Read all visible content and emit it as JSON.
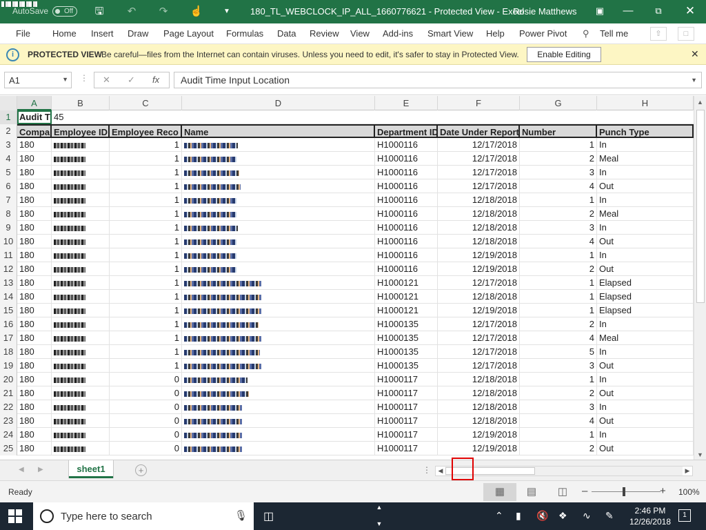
{
  "titlebar": {
    "autosave_label": "AutoSave",
    "autosave_state": "Off",
    "doc_title": "180_TL_WEBCLOCK_IP_ALL_1660776621 - Protected View - Excel",
    "user_name": "Rosie Matthews"
  },
  "menu": {
    "items": [
      "File",
      "Home",
      "Insert",
      "Draw",
      "Page Layout",
      "Formulas",
      "Data",
      "Review",
      "View",
      "Add-ins",
      "Smart View",
      "Help",
      "Power Pivot"
    ],
    "tell_me": "Tell me"
  },
  "protected_view": {
    "title": "PROTECTED VIEW",
    "message": "Be careful—files from the Internet can contain viruses. Unless you need to edit, it's safer to stay in Protected View.",
    "enable_button": "Enable Editing"
  },
  "formula_bar": {
    "name_box": "A1",
    "fx_label": "fx",
    "content": "Audit Time Input Location"
  },
  "columns": [
    "A",
    "B",
    "C",
    "D",
    "E",
    "F",
    "G",
    "H"
  ],
  "row1": {
    "a": "Audit T",
    "b": "45"
  },
  "header_row": [
    "Compa",
    "Employee ID",
    "Employee Reco",
    "Name",
    "Department ID",
    "Date Under Report",
    "Number",
    "Punch Type"
  ],
  "rows": [
    {
      "n": "3",
      "a": "180",
      "c": "1",
      "e": "H1000116",
      "f": "12/17/2018",
      "g": "1",
      "h": "In"
    },
    {
      "n": "4",
      "a": "180",
      "c": "1",
      "e": "H1000116",
      "f": "12/17/2018",
      "g": "2",
      "h": "Meal"
    },
    {
      "n": "5",
      "a": "180",
      "c": "1",
      "e": "H1000116",
      "f": "12/17/2018",
      "g": "3",
      "h": "In"
    },
    {
      "n": "6",
      "a": "180",
      "c": "1",
      "e": "H1000116",
      "f": "12/17/2018",
      "g": "4",
      "h": "Out"
    },
    {
      "n": "7",
      "a": "180",
      "c": "1",
      "e": "H1000116",
      "f": "12/18/2018",
      "g": "1",
      "h": "In"
    },
    {
      "n": "8",
      "a": "180",
      "c": "1",
      "e": "H1000116",
      "f": "12/18/2018",
      "g": "2",
      "h": "Meal"
    },
    {
      "n": "9",
      "a": "180",
      "c": "1",
      "e": "H1000116",
      "f": "12/18/2018",
      "g": "3",
      "h": "In"
    },
    {
      "n": "10",
      "a": "180",
      "c": "1",
      "e": "H1000116",
      "f": "12/18/2018",
      "g": "4",
      "h": "Out"
    },
    {
      "n": "11",
      "a": "180",
      "c": "1",
      "e": "H1000116",
      "f": "12/19/2018",
      "g": "1",
      "h": "In"
    },
    {
      "n": "12",
      "a": "180",
      "c": "1",
      "e": "H1000116",
      "f": "12/19/2018",
      "g": "2",
      "h": "Out"
    },
    {
      "n": "13",
      "a": "180",
      "c": "1",
      "e": "H1000121",
      "f": "12/17/2018",
      "g": "1",
      "h": "Elapsed"
    },
    {
      "n": "14",
      "a": "180",
      "c": "1",
      "e": "H1000121",
      "f": "12/18/2018",
      "g": "1",
      "h": "Elapsed"
    },
    {
      "n": "15",
      "a": "180",
      "c": "1",
      "e": "H1000121",
      "f": "12/19/2018",
      "g": "1",
      "h": "Elapsed"
    },
    {
      "n": "16",
      "a": "180",
      "c": "1",
      "e": "H1000135",
      "f": "12/17/2018",
      "g": "2",
      "h": "In"
    },
    {
      "n": "17",
      "a": "180",
      "c": "1",
      "e": "H1000135",
      "f": "12/17/2018",
      "g": "4",
      "h": "Meal"
    },
    {
      "n": "18",
      "a": "180",
      "c": "1",
      "e": "H1000135",
      "f": "12/17/2018",
      "g": "5",
      "h": "In"
    },
    {
      "n": "19",
      "a": "180",
      "c": "1",
      "e": "H1000135",
      "f": "12/17/2018",
      "g": "3",
      "h": "Out"
    },
    {
      "n": "20",
      "a": "180",
      "c": "0",
      "e": "H1000117",
      "f": "12/18/2018",
      "g": "1",
      "h": "In"
    },
    {
      "n": "21",
      "a": "180",
      "c": "0",
      "e": "H1000117",
      "f": "12/18/2018",
      "g": "2",
      "h": "Out"
    },
    {
      "n": "22",
      "a": "180",
      "c": "0",
      "e": "H1000117",
      "f": "12/18/2018",
      "g": "3",
      "h": "In"
    },
    {
      "n": "23",
      "a": "180",
      "c": "0",
      "e": "H1000117",
      "f": "12/18/2018",
      "g": "4",
      "h": "Out"
    },
    {
      "n": "24",
      "a": "180",
      "c": "0",
      "e": "H1000117",
      "f": "12/19/2018",
      "g": "1",
      "h": "In"
    },
    {
      "n": "25",
      "a": "180",
      "c": "0",
      "e": "H1000117",
      "f": "12/19/2018",
      "g": "2",
      "h": "Out"
    }
  ],
  "row_labels": {
    "r1": "1",
    "r2": "2"
  },
  "sheet_tab": "sheet1",
  "status": {
    "ready": "Ready",
    "zoom": "100%"
  },
  "taskbar": {
    "search_placeholder": "Type here to search",
    "time": "2:46 PM",
    "date": "12/26/2018",
    "notif_count": "1"
  },
  "colors": {
    "excel_green": "#217346",
    "protected_yellow": "#fdf6c4",
    "taskbar": "#1c2733"
  }
}
